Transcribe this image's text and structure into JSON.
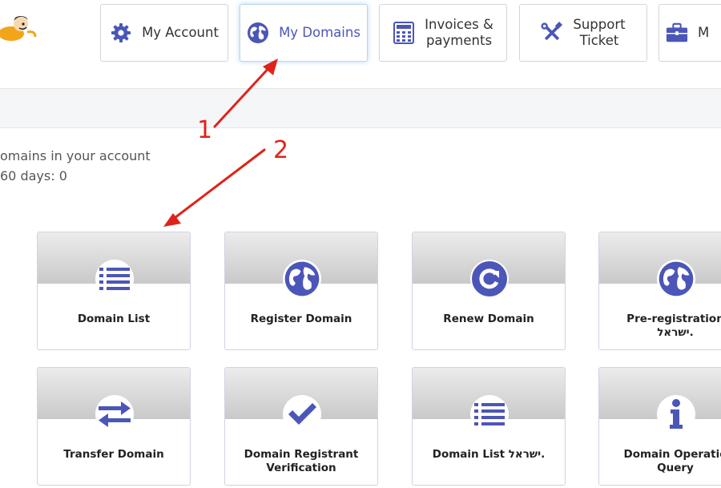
{
  "nav": {
    "account": "My Account",
    "domains": "My Domains",
    "invoices_line1": "Invoices &",
    "invoices_line2": "payments",
    "support_line1": "Support",
    "support_line2": "Ticket",
    "more": "M"
  },
  "info": {
    "line1": "omains in your account",
    "line2": "60 days: 0"
  },
  "cards": [
    {
      "label": "Domain List",
      "icon": "list-icon"
    },
    {
      "label": "Register Domain",
      "icon": "globe-icon"
    },
    {
      "label": "Renew Domain",
      "icon": "refresh-icon"
    },
    {
      "label_line1": "Pre-registration",
      "label_line2": "ישראל.",
      "icon": "globe-icon"
    },
    {
      "label": "Transfer Domain",
      "icon": "transfer-icon"
    },
    {
      "label_line1": "Domain Registrant",
      "label_line2": "Verification",
      "icon": "check-icon"
    },
    {
      "label": "Domain List ישראל.",
      "icon": "list-icon"
    },
    {
      "label_line1": "Domain Operatio",
      "label_line2": "Query",
      "icon": "info-icon"
    }
  ],
  "annotations": {
    "one": "1",
    "two": "2"
  },
  "colors": {
    "accent": "#4b56b8",
    "arrow": "#e0231a",
    "card_border": "#cfd3e6"
  }
}
